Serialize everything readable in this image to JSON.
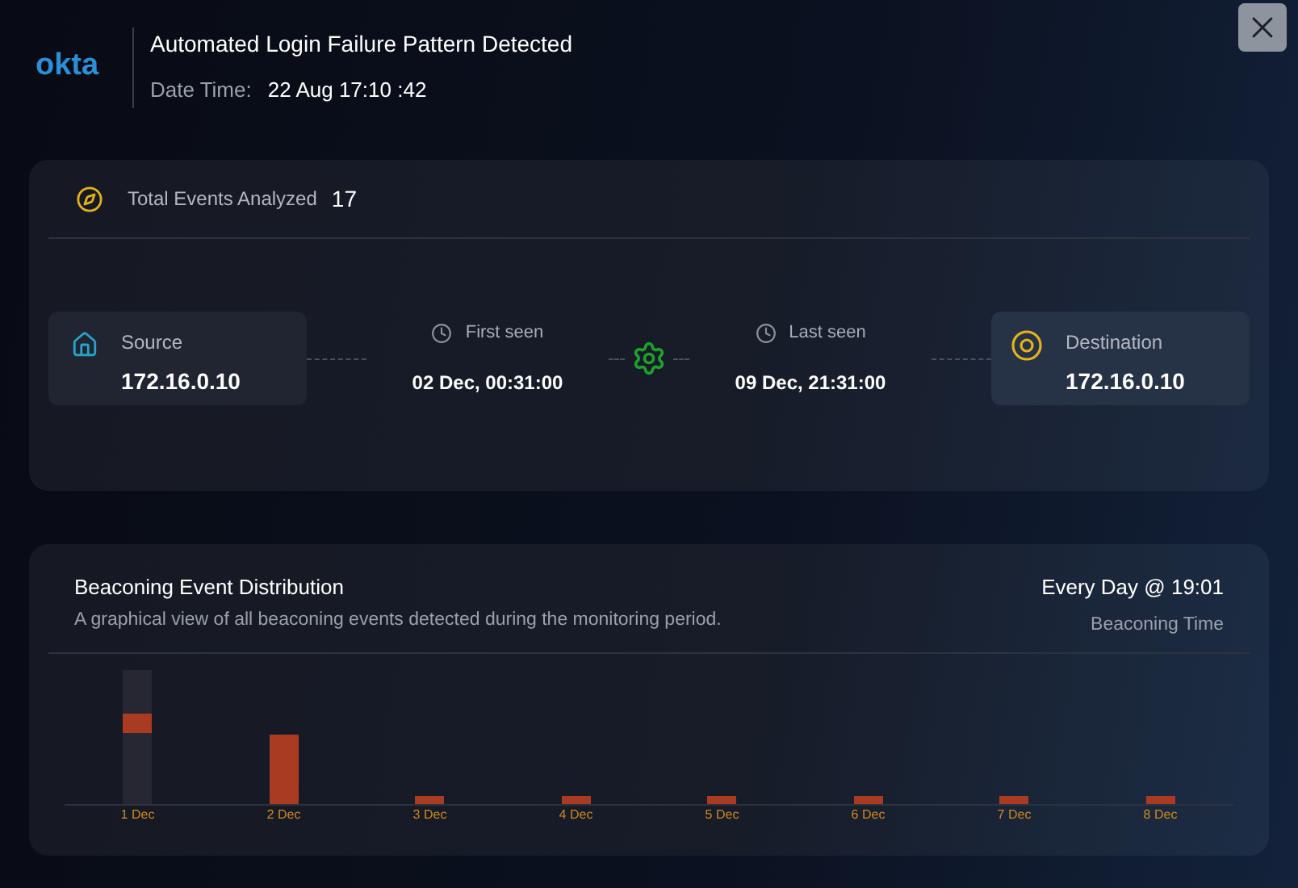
{
  "header": {
    "logo": "okta",
    "title": "Automated Login Failure Pattern Detected",
    "date_label": "Date Time:",
    "date_value": "22 Aug 17:10 :42"
  },
  "summary": {
    "label": "Total Events Analyzed",
    "count": "17",
    "source": {
      "label": "Source",
      "value": "172.16.0.10"
    },
    "first_seen": {
      "label": "First seen",
      "value": "02 Dec, 00:31:00"
    },
    "last_seen": {
      "label": "Last seen",
      "value": "09 Dec, 21:31:00"
    },
    "destination": {
      "label": "Destination",
      "value": "172.16.0.10"
    }
  },
  "distribution": {
    "title": "Beaconing Event Distribution",
    "subtitle": "A graphical view of all beaconing events detected during the monitoring period.",
    "schedule": "Every Day @ 19:01",
    "schedule_label": "Beaconing Time",
    "x_labels": [
      "1 Dec",
      "2 Dec",
      "3 Dec",
      "4 Dec",
      "5 Dec",
      "6 Dec",
      "7 Dec",
      "8 Dec"
    ]
  }
}
